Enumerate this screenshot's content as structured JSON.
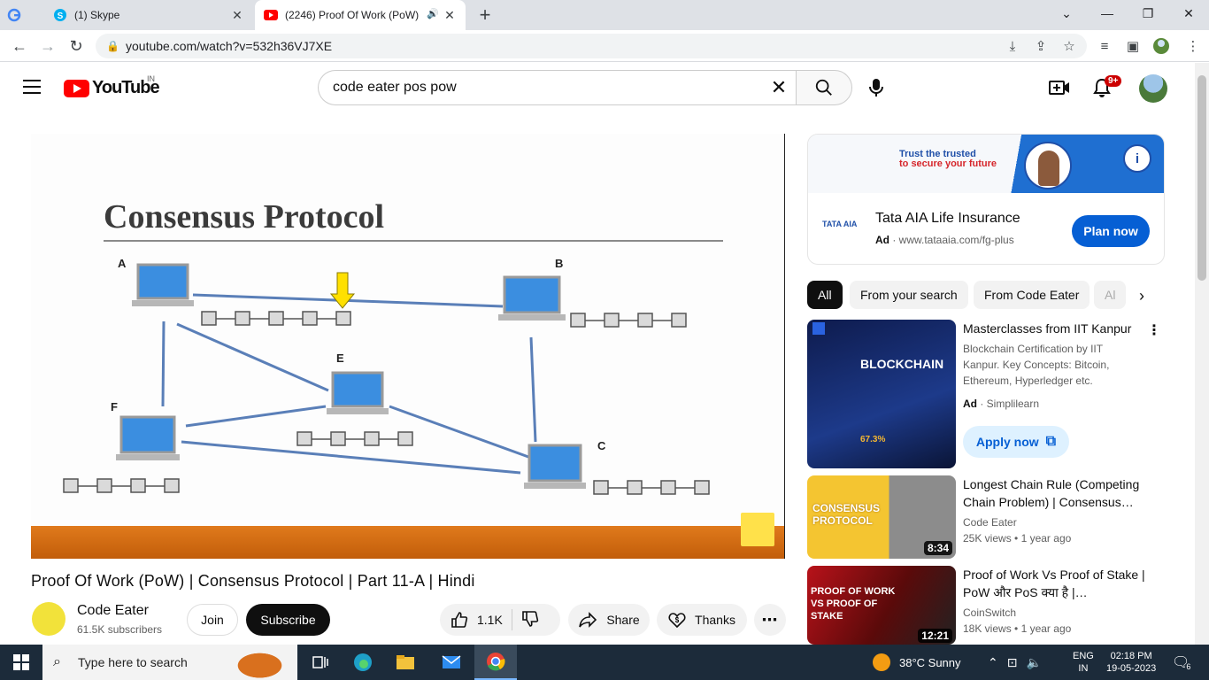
{
  "browser": {
    "tabs": [
      {
        "label": ""
      },
      {
        "label": "(1) Skype"
      },
      {
        "label": "(2246) Proof Of Work (PoW)"
      }
    ],
    "url": "youtube.com/watch?v=532h36VJ7XE"
  },
  "header": {
    "logo_text": "YouTube",
    "country": "IN",
    "search_value": "code eater pos pow",
    "notification_count": "9+"
  },
  "slide": {
    "title": "Consensus Protocol",
    "nodes": [
      "A",
      "B",
      "E",
      "F",
      "C"
    ]
  },
  "video": {
    "title": "Proof Of Work (PoW) | Consensus Protocol | Part 11-A | Hindi",
    "channel_name": "Code Eater",
    "subscribers": "61.5K subscribers",
    "join_label": "Join",
    "subscribe_label": "Subscribe",
    "likes": "1.1K",
    "share_label": "Share",
    "thanks_label": "Thanks"
  },
  "ad": {
    "tagline_1": "Trust the trusted",
    "tagline_2": "to secure your future",
    "logo": "TATA AIA",
    "title": "Tata AIA Life Insurance",
    "badge": "Ad",
    "url": "www.tataaia.com/fg-plus",
    "cta": "Plan now"
  },
  "chips": [
    "All",
    "From your search",
    "From Code Eater",
    "Al"
  ],
  "recommendations": [
    {
      "title": "Masterclasses from IIT Kanpur",
      "description": "Blockchain Certification by IIT Kanpur. Key Concepts: Bitcoin, Ethereum, Hyperledger etc.",
      "badge": "Ad",
      "advertiser": "Simplilearn",
      "cta": "Apply now",
      "thumb_heading": "BLOCKCHAIN",
      "thumb_stat": "67.3%"
    },
    {
      "title": "Longest Chain Rule (Competing Chain Problem) | Consensus…",
      "channel": "Code Eater",
      "views": "25K views",
      "age": "1 year ago",
      "duration": "8:34",
      "thumb_heading": "CONSENSUS PROTOCOL"
    },
    {
      "title": "Proof of Work Vs Proof of Stake | PoW और PoS क्या है |…",
      "channel": "CoinSwitch",
      "views": "18K views",
      "age": "1 year ago",
      "duration": "12:21",
      "thumb_heading": "PROOF OF WORK VS PROOF OF STAKE"
    }
  ],
  "taskbar": {
    "search_placeholder": "Type here to search",
    "weather": "38°C  Sunny",
    "lang_1": "ENG",
    "lang_2": "IN",
    "time": "02:18 PM",
    "date": "19-05-2023",
    "notifications": "6"
  },
  "colors": {
    "youtube_red": "#ff0000",
    "subscribe_bg": "#0f0f0f",
    "link_blue": "#065fd4",
    "slide_orange": "#d96b12"
  }
}
